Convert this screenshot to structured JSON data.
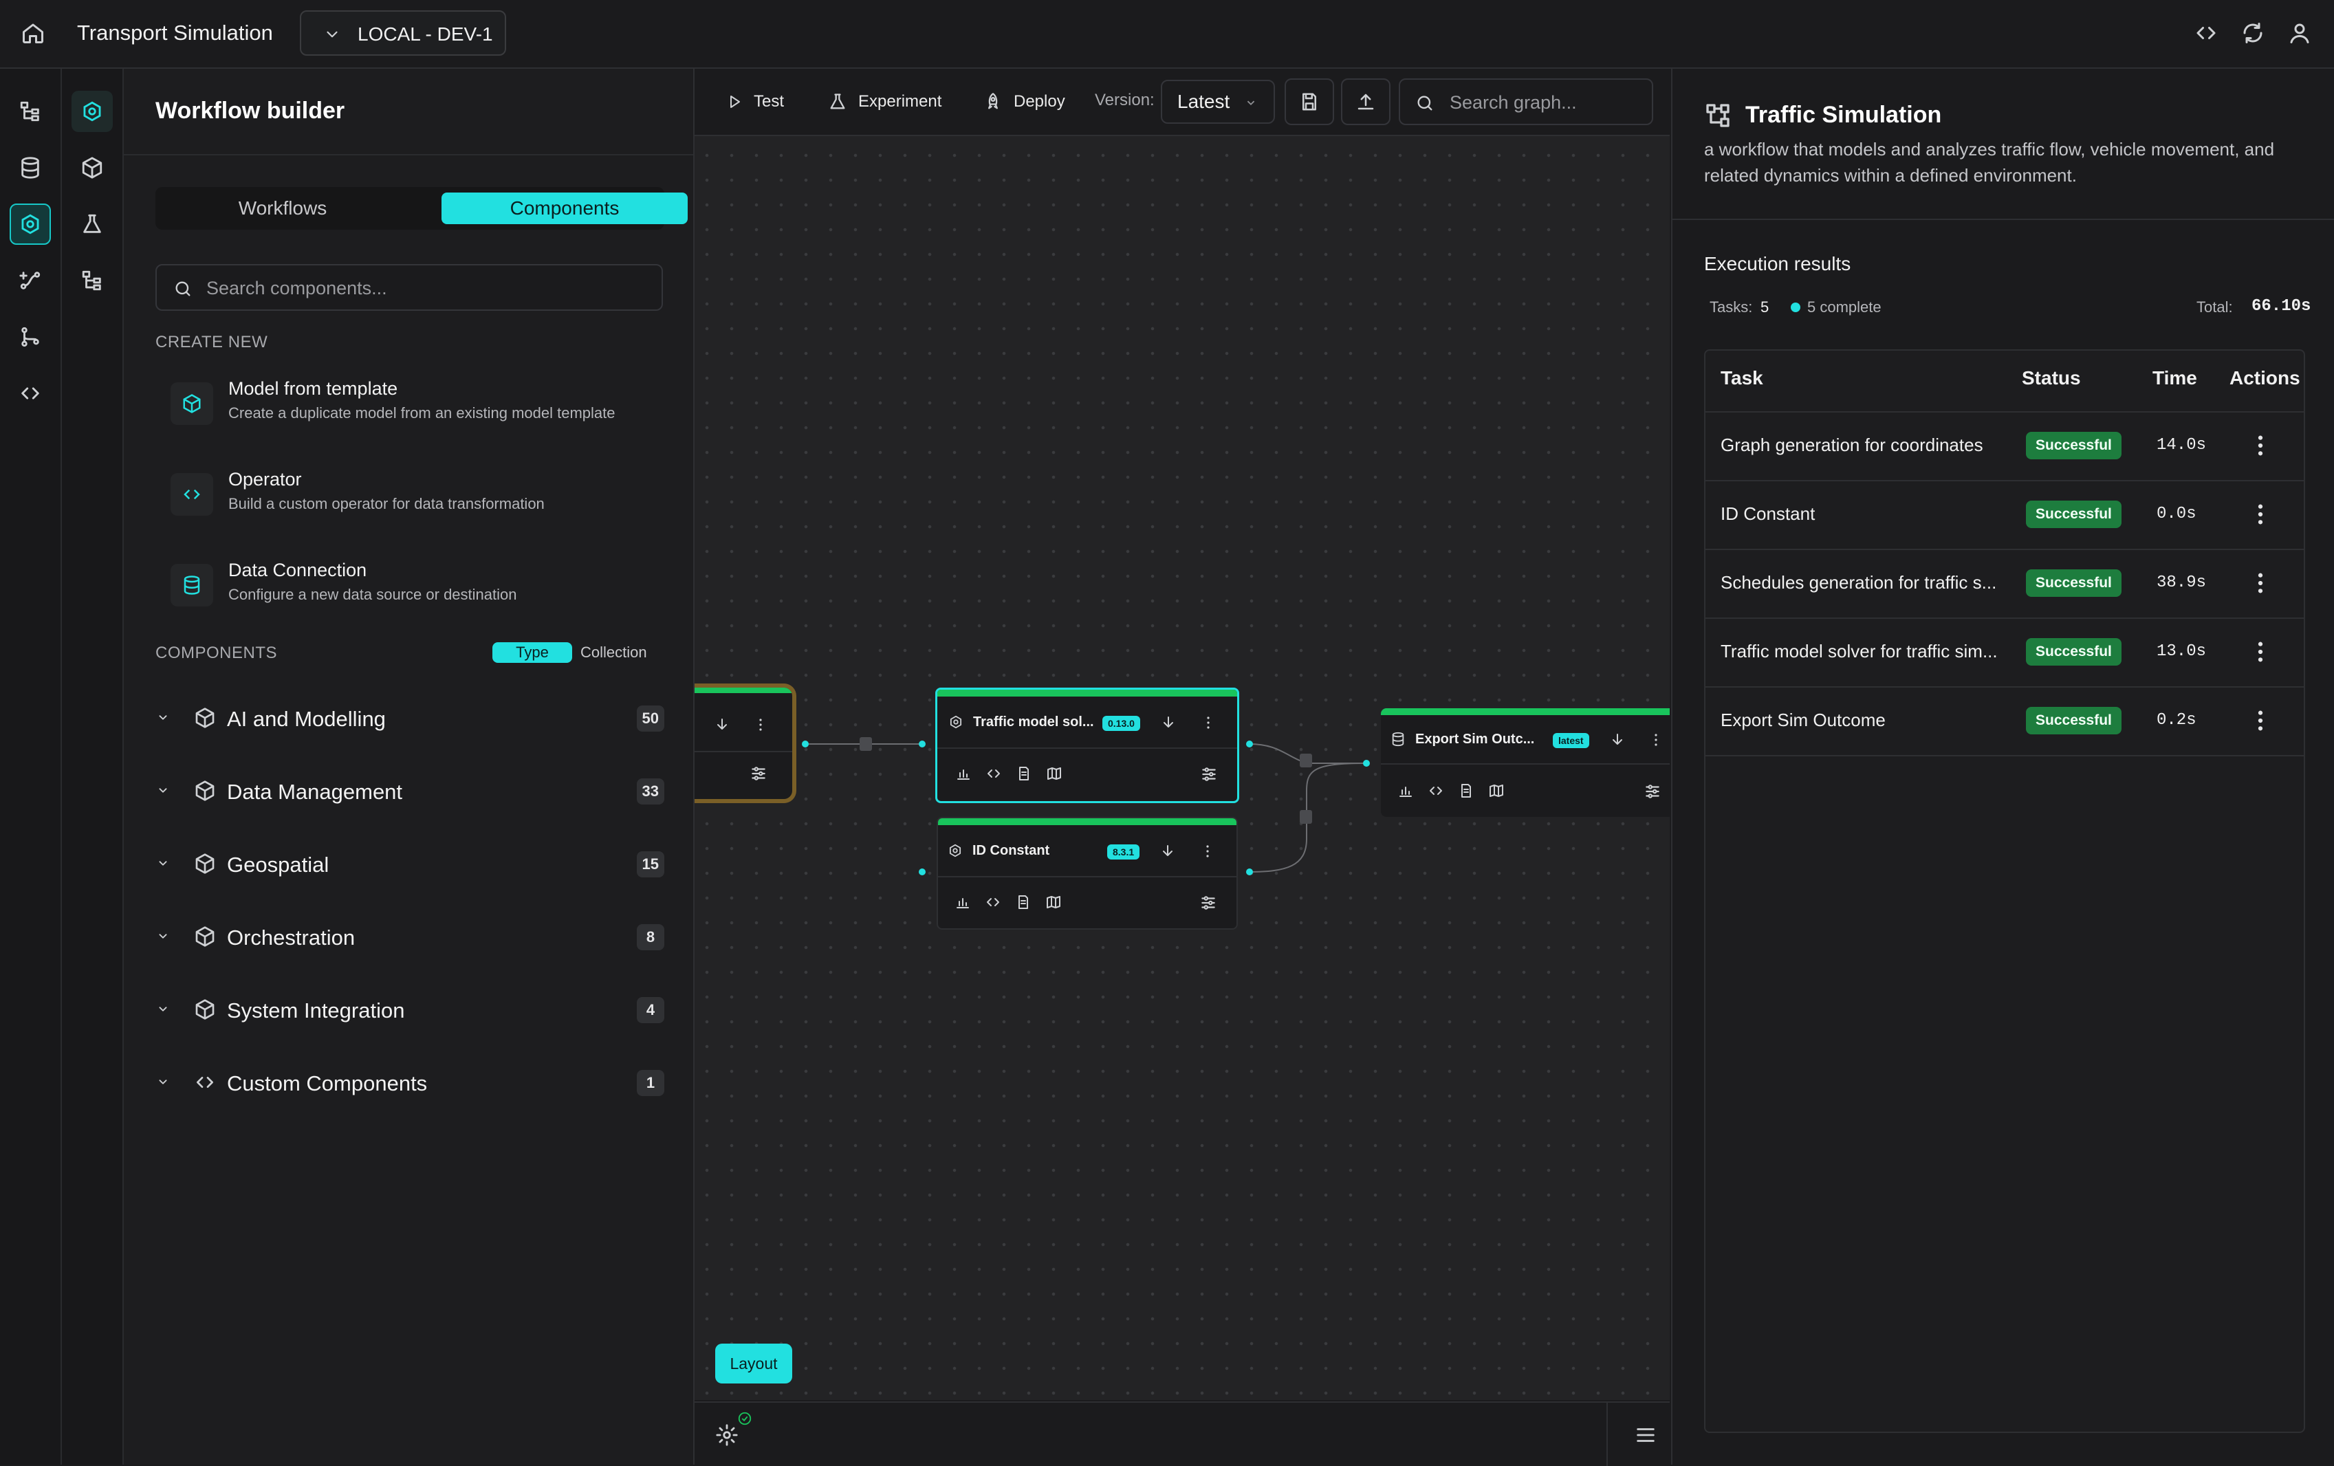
{
  "app": {
    "title": "Transport Simulation",
    "environment": "LOCAL - DEV-1"
  },
  "left_panel": {
    "title": "Workflow builder",
    "tabs": [
      "Workflows",
      "Components"
    ],
    "active_tab": "Components",
    "search_placeholder": "Search components...",
    "create_new_header": "CREATE NEW",
    "create_new": [
      {
        "title": "Model from template",
        "desc": "Create a duplicate model from an existing model template",
        "icon": "cube-icon"
      },
      {
        "title": "Operator",
        "desc": "Build a custom operator for data transformation",
        "icon": "code-icon"
      },
      {
        "title": "Data Connection",
        "desc": "Configure a new data source or destination",
        "icon": "database-icon"
      }
    ],
    "components_header": "COMPONENTS",
    "toggle": {
      "type": "Type",
      "collection": "Collection"
    },
    "categories": [
      {
        "label": "AI and Modelling",
        "count": "50"
      },
      {
        "label": "Data Management",
        "count": "33"
      },
      {
        "label": "Geospatial",
        "count": "15"
      },
      {
        "label": "Orchestration",
        "count": "8"
      },
      {
        "label": "System Integration",
        "count": "4"
      },
      {
        "label": "Custom Components",
        "count": "1"
      }
    ]
  },
  "toolbar": {
    "test": "Test",
    "experiment": "Experiment",
    "deploy": "Deploy",
    "version_label": "Version:",
    "version_value": "Latest",
    "search_placeholder": "Search graph..."
  },
  "canvas": {
    "nodes": [
      {
        "title": "Traffic model sol...",
        "version": "0.13.0"
      },
      {
        "title": "ID Constant",
        "version": "8.3.1"
      },
      {
        "title": "Export Sim Outc...",
        "version": "latest"
      }
    ],
    "layout_button": "Layout"
  },
  "right_panel": {
    "title": "Traffic Simulation",
    "description": "a workflow that models and analyzes traffic flow, vehicle movement, and related dynamics within a defined environment.",
    "execution_title": "Execution results",
    "tasks_label": "Tasks:",
    "tasks_value": "5",
    "complete_label": "5 complete",
    "total_label": "Total:",
    "total_value": "66.10s",
    "columns": [
      "Task",
      "Status",
      "Time",
      "Actions"
    ],
    "rows": [
      {
        "task": "Graph generation for coordinates",
        "status": "Successful",
        "time": "14.0s"
      },
      {
        "task": "ID Constant",
        "status": "Successful",
        "time": "0.0s"
      },
      {
        "task": "Schedules generation for traffic s...",
        "status": "Successful",
        "time": "38.9s"
      },
      {
        "task": "Traffic model solver for traffic sim...",
        "status": "Successful",
        "time": "13.0s"
      },
      {
        "task": "Export Sim Outcome",
        "status": "Successful",
        "time": "0.2s"
      }
    ]
  },
  "colors": {
    "accent": "#22e0e0",
    "success": "#1d7d3e",
    "node_bar": "#19c45c",
    "selected_node_border": "#8a6a2a"
  }
}
